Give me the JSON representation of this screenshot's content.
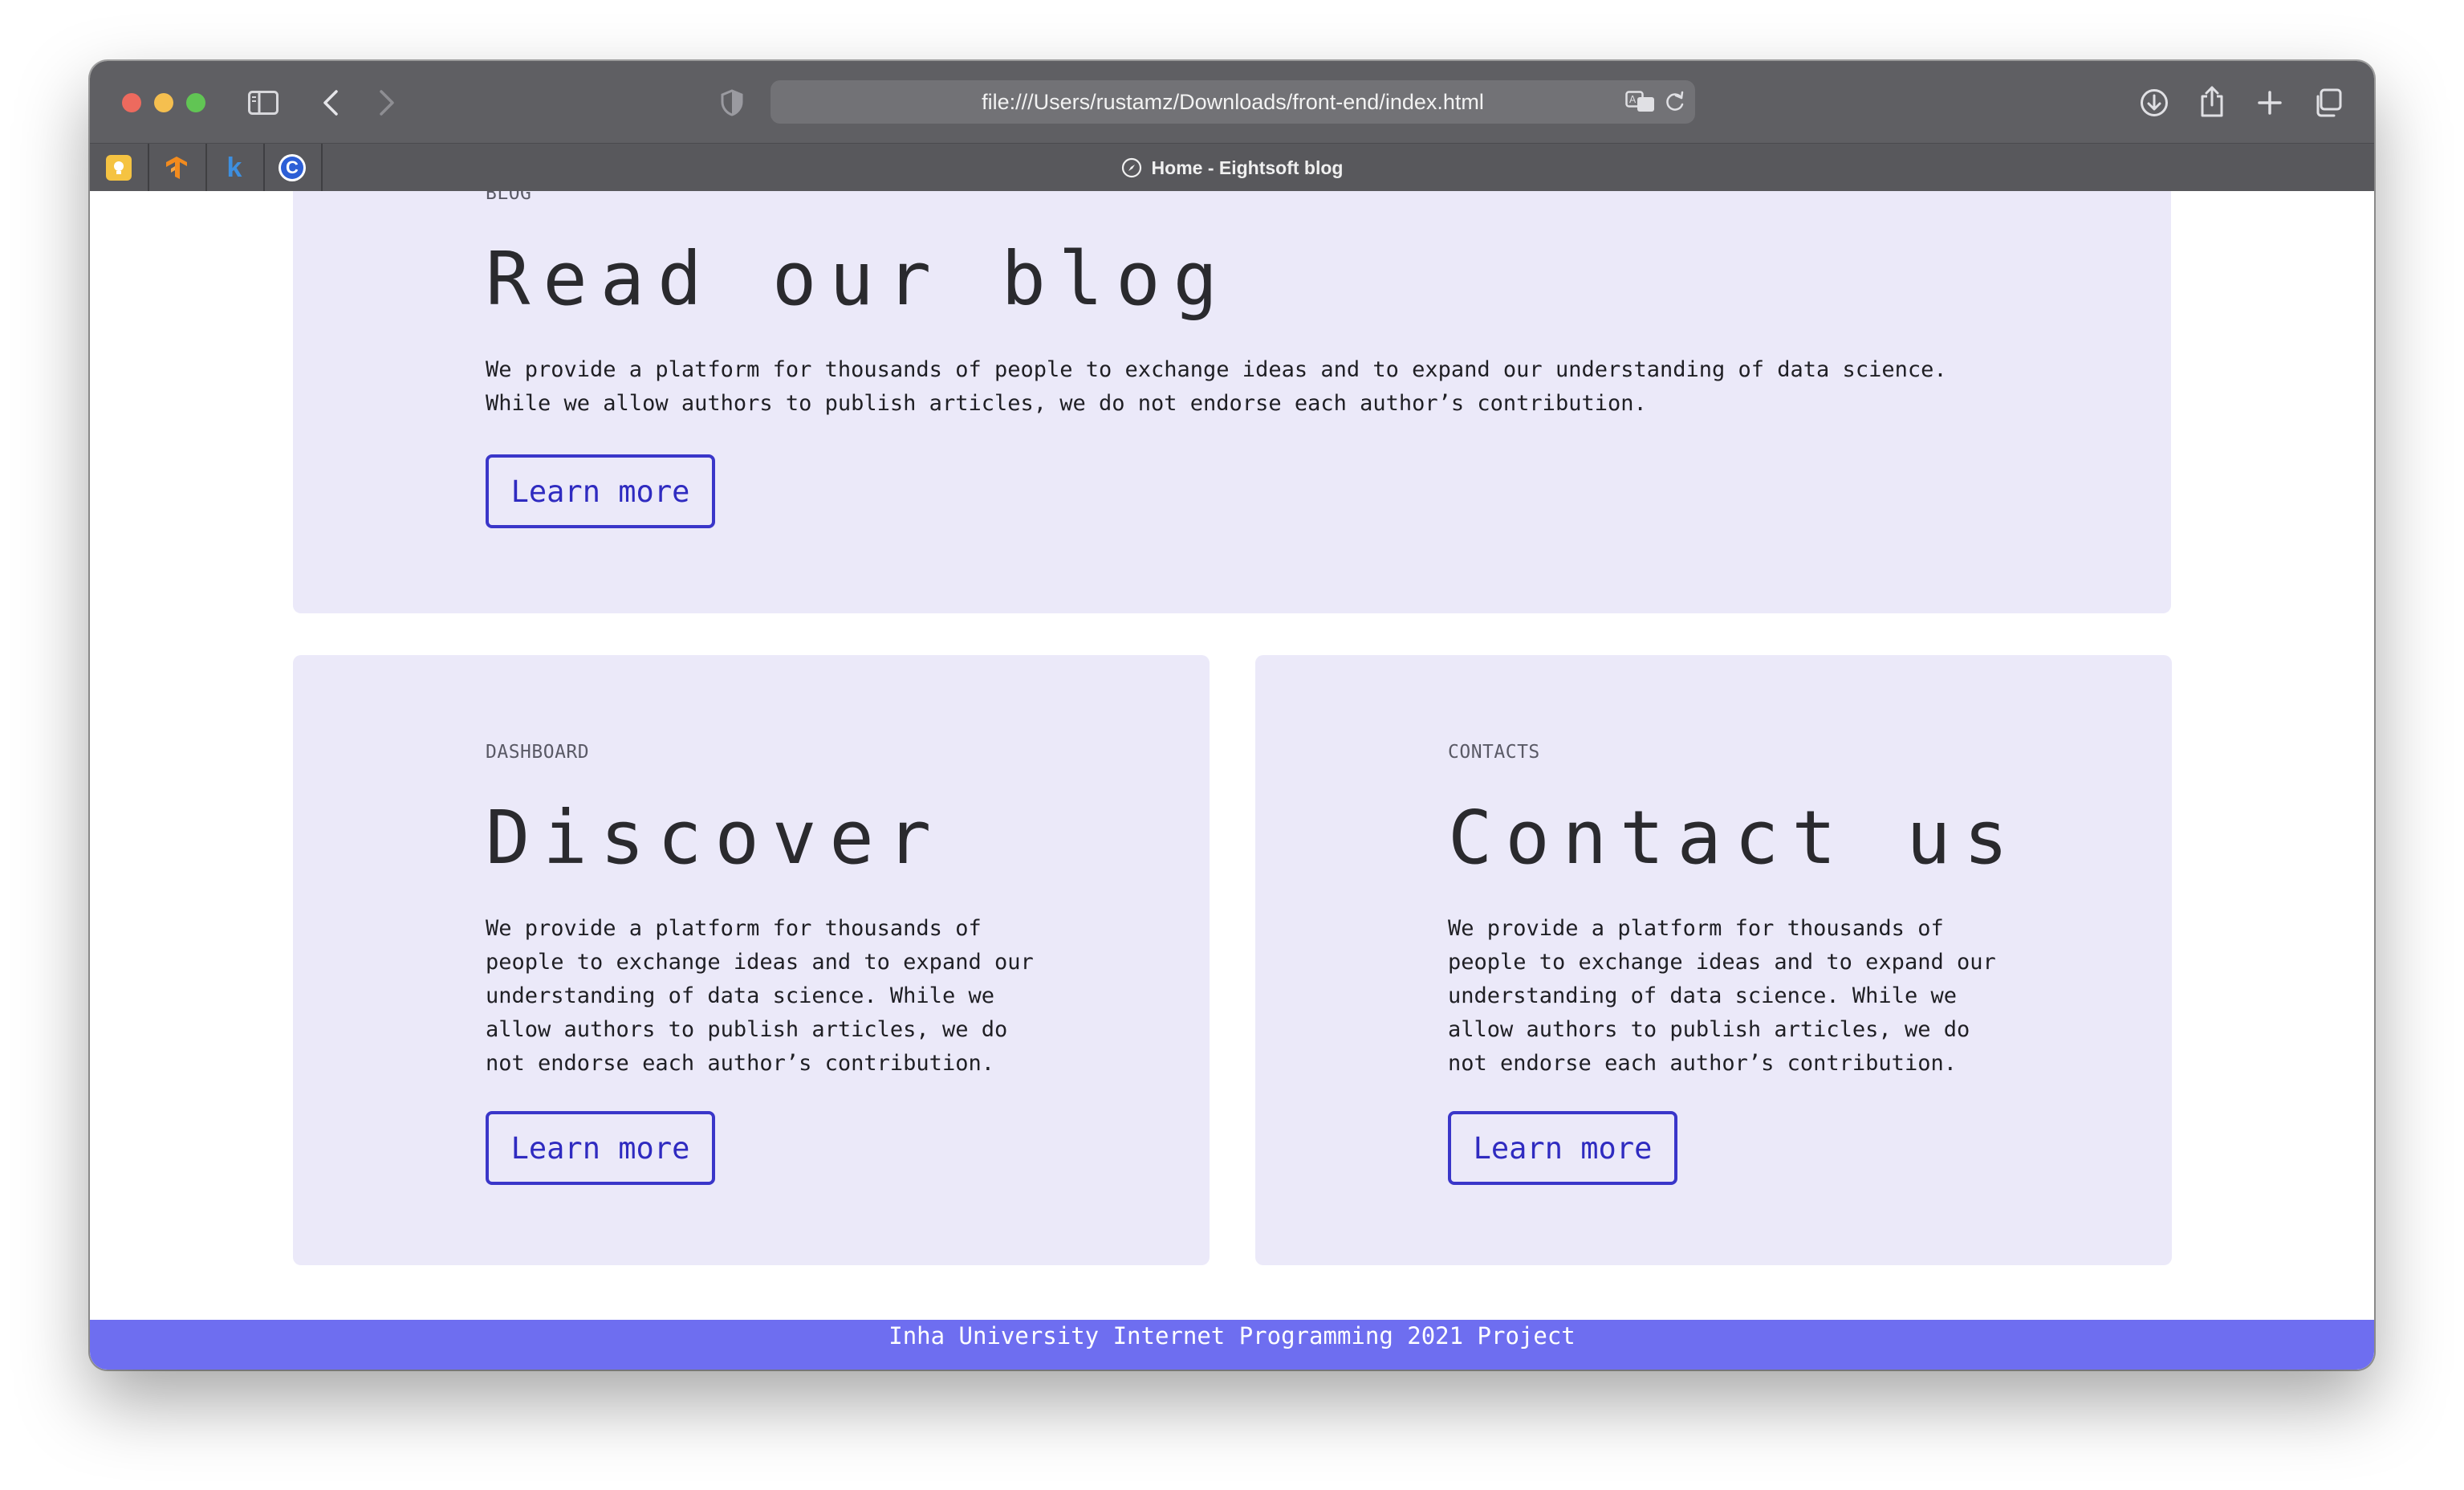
{
  "browser": {
    "url": "file:///Users/rustamz/Downloads/front-end/index.html",
    "active_tab_title": "Home - Eightsoft blog",
    "pinned_tabs": [
      {
        "icon": "lightbulb-app-icon",
        "color": "#f5c342"
      },
      {
        "icon": "tensorflow-icon",
        "color": "#f28b1e"
      },
      {
        "icon": "k-letter-icon",
        "glyph": "k",
        "color": "#3d8fe0"
      },
      {
        "icon": "c-letter-icon",
        "glyph": "C",
        "color": "#2d5fd6"
      }
    ]
  },
  "sections": {
    "blog": {
      "eyebrow": "BLOG",
      "title": "Read our blog",
      "description": "We provide a platform for thousands of people to exchange ideas and to expand our understanding of data science. While we allow authors to publish articles, we do not endorse each author’s contribution.",
      "button": "Learn more"
    },
    "dashboard": {
      "eyebrow": "DASHBOARD",
      "title": "Discover",
      "description": "We provide a platform for thousands of people to exchange ideas and to expand our understanding of data science. While we allow authors to publish articles, we do not endorse each author’s contribution.",
      "button": "Learn more"
    },
    "contacts": {
      "eyebrow": "CONTACTS",
      "title": "Contact us",
      "description": "We provide a platform for thousands of people to exchange ideas and to expand our understanding of data science. While we allow authors to publish articles, we do not endorse each author’s contribution.",
      "button": "Learn more"
    }
  },
  "footer": {
    "text": "Inha University Internet Programming 2021 Project"
  },
  "colors": {
    "card_background": "#ebe9f9",
    "accent": "#3a36c9",
    "footer_background": "#6e6ef0"
  }
}
